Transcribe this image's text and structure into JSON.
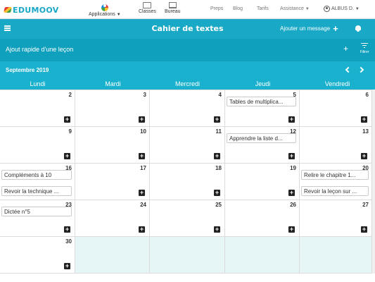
{
  "app": {
    "logo_text": "EDUMOOV"
  },
  "topnav": {
    "applications": "Applications",
    "classes": "Classes",
    "bureau": "Bureau",
    "links": [
      "Preps",
      "Blog",
      "Tarifs",
      "Assistance"
    ],
    "user": "ALBUS D."
  },
  "titlebar": {
    "title": "Cahier de textes",
    "add_message": "Ajouter un message",
    "add_icon": "+"
  },
  "quickbar": {
    "label": "Ajout rapide d'une leçon",
    "plus": "+",
    "filter_label": "Filtrer"
  },
  "calendar": {
    "month": "Septembre 2019",
    "weekdays": [
      "Lundi",
      "Mardi",
      "Mercredi",
      "Jeudi",
      "Vendredi"
    ],
    "weeks": [
      {
        "days": [
          "2",
          "3",
          "4",
          "5",
          "6"
        ]
      },
      {
        "days": [
          "9",
          "10",
          "11",
          "12",
          "13"
        ]
      },
      {
        "days": [
          "16",
          "17",
          "18",
          "19",
          "20"
        ]
      },
      {
        "days": [
          "23",
          "24",
          "25",
          "26",
          "27"
        ]
      },
      {
        "days": [
          "30",
          "",
          "",
          "",
          ""
        ]
      }
    ],
    "events": [
      {
        "week": 0,
        "day": 3,
        "slot": 0,
        "text": "Tables de multiplica...",
        "color": "#e53935"
      },
      {
        "week": 1,
        "day": 3,
        "slot": 0,
        "text": "Apprendre la liste d...",
        "color": "#1e6fc7"
      },
      {
        "week": 2,
        "day": 0,
        "slot": 0,
        "text": "Compléments à 10",
        "color": "#e53935"
      },
      {
        "week": 2,
        "day": 0,
        "slot": 1,
        "text": "Revoir la technique ...",
        "color": "#e53935"
      },
      {
        "week": 2,
        "day": 4,
        "slot": 0,
        "text": "Relire le chapitre 1...",
        "color": "#1e6fc7"
      },
      {
        "week": 2,
        "day": 4,
        "slot": 1,
        "text": "Revoir la leçon sur ...",
        "color": "#7cb342"
      },
      {
        "week": 3,
        "day": 0,
        "slot": 0,
        "text": "Dictée n°5",
        "color": "#1e6fc7"
      }
    ],
    "add_icon": "+"
  },
  "colors": {
    "accent": "#19a9c7",
    "quickbar": "#0fa0be",
    "monthbar": "#19b1ce"
  }
}
